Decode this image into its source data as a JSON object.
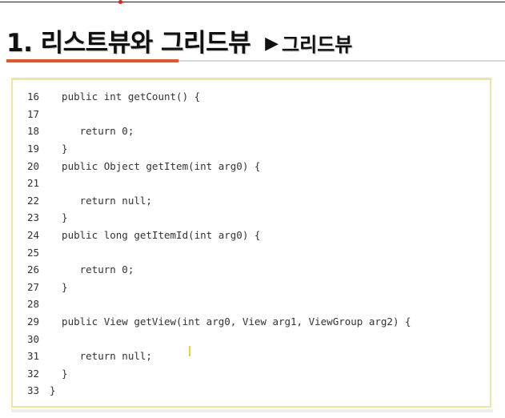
{
  "slide": {
    "title": "1. 리스트뷰와 그리드뷰",
    "arrow": "▶",
    "subtitle": "그리드뷰",
    "accent_color": "#e8542a",
    "panel_border_color": "#ede7a3"
  },
  "code": {
    "lines": [
      {
        "num": "16",
        "text": "  public int getCount() {"
      },
      {
        "num": "17",
        "text": ""
      },
      {
        "num": "18",
        "text": "     return 0;"
      },
      {
        "num": "19",
        "text": "  }"
      },
      {
        "num": "20",
        "text": "  public Object getItem(int arg0) {"
      },
      {
        "num": "21",
        "text": ""
      },
      {
        "num": "22",
        "text": "     return null;"
      },
      {
        "num": "23",
        "text": "  }"
      },
      {
        "num": "24",
        "text": "  public long getItemId(int arg0) {"
      },
      {
        "num": "25",
        "text": ""
      },
      {
        "num": "26",
        "text": "     return 0;"
      },
      {
        "num": "27",
        "text": "  }"
      },
      {
        "num": "28",
        "text": ""
      },
      {
        "num": "29",
        "text": "  public View getView(int arg0, View arg1, ViewGroup arg2) {"
      },
      {
        "num": "30",
        "text": ""
      },
      {
        "num": "31",
        "text": "     return null;"
      },
      {
        "num": "32",
        "text": "  }"
      },
      {
        "num": "33",
        "text": "}"
      }
    ]
  }
}
